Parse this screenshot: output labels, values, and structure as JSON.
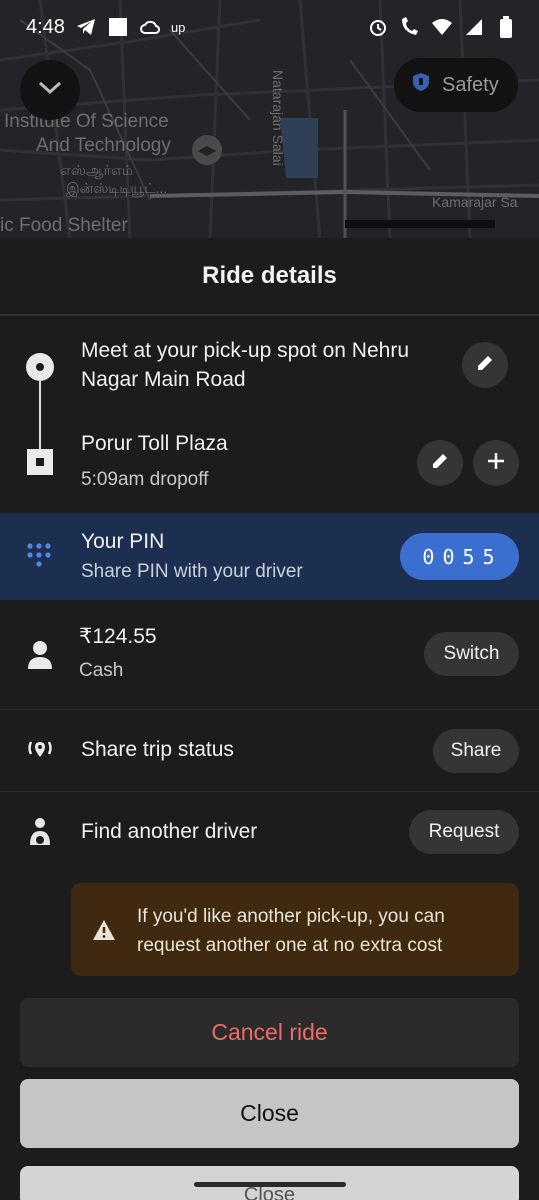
{
  "status_bar": {
    "time": "4:48",
    "up_label": "up"
  },
  "map": {
    "labels": [
      "Institute Of Science",
      "And Technology",
      "எஸ்ஆர்எம்",
      "இன்ஸ்டிடியூட்...",
      "Natarajan Salai",
      "Kamarajar Sa",
      "ic Food Shelter"
    ],
    "safety_label": "Safety"
  },
  "sheet": {
    "title": "Ride details",
    "pickup_text": "Meet at your pick-up spot on Nehru Nagar Main Road",
    "dropoff_title": "Porur Toll Plaza",
    "dropoff_time": "5:09am dropoff",
    "pin": {
      "title": "Your PIN",
      "subtitle": "Share PIN with your driver",
      "value": "0055"
    },
    "payment": {
      "amount": "₹124.55",
      "method": "Cash",
      "switch_label": "Switch"
    },
    "share": {
      "label": "Share trip status",
      "button": "Share"
    },
    "another_driver": {
      "label": "Find another driver",
      "button": "Request"
    },
    "warning": "If you'd like another pick-up, you can request another one at no extra cost",
    "cancel_label": "Cancel ride",
    "close_label": "Close",
    "peek_label": "Close"
  },
  "colors": {
    "pin_bg": "#1d2f51",
    "pin_badge": "#3a6fd0",
    "cancel_text": "#ed6a6a",
    "warning_bg": "#3f2a11"
  }
}
